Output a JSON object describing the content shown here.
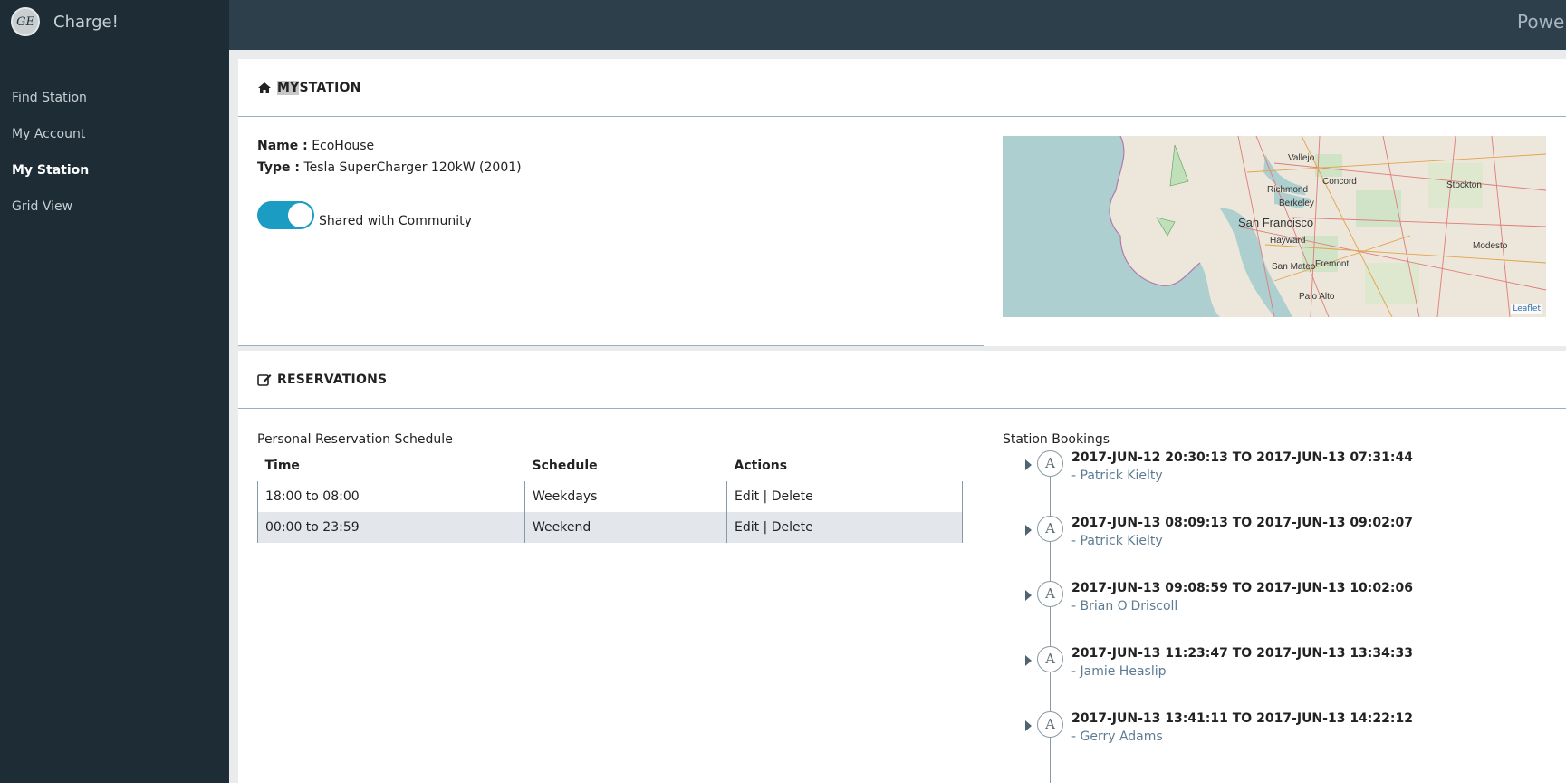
{
  "app": {
    "name": "Charge!",
    "logo_text": "GE",
    "topbar_title": "Powe"
  },
  "nav": {
    "items": [
      {
        "label": "Find Station"
      },
      {
        "label": "My Account"
      },
      {
        "label": "My Station",
        "active": true
      },
      {
        "label": "Grid View"
      }
    ]
  },
  "station": {
    "header_prefix": "MY",
    "header_rest": " STATION",
    "name_label": "Name :",
    "name_value": "EcoHouse",
    "type_label": "Type :",
    "type_value": "Tesla SuperCharger 120kW (2001)",
    "shared_label": "Shared with Community",
    "shared_on": true,
    "map": {
      "attribution": "Leaflet",
      "cities": [
        "Vallejo",
        "Concord",
        "Stockton",
        "Richmond",
        "Berkeley",
        "San Francisco",
        "Hayward",
        "Modesto",
        "San Mateo",
        "Fremont",
        "Palo Alto"
      ]
    }
  },
  "reservations": {
    "header": "RESERVATIONS",
    "personal_title": "Personal Reservation Schedule",
    "columns": [
      "Time",
      "Schedule",
      "Actions"
    ],
    "rows": [
      {
        "time": "18:00 to 08:00",
        "schedule": "Weekdays",
        "actions": "Edit | Delete"
      },
      {
        "time": "00:00 to 23:59",
        "schedule": "Weekend",
        "actions": "Edit | Delete"
      }
    ],
    "bookings_title": "Station Bookings",
    "bookings": [
      {
        "avatar": "A",
        "time": "2017-JUN-12 20:30:13 TO 2017-JUN-13 07:31:44",
        "user": "- Patrick Kielty"
      },
      {
        "avatar": "A",
        "time": "2017-JUN-13 08:09:13 TO 2017-JUN-13 09:02:07",
        "user": "- Patrick Kielty"
      },
      {
        "avatar": "A",
        "time": "2017-JUN-13 09:08:59 TO 2017-JUN-13 10:02:06",
        "user": "- Brian O'Driscoll"
      },
      {
        "avatar": "A",
        "time": "2017-JUN-13 11:23:47 TO 2017-JUN-13 13:34:33",
        "user": "- Jamie Heaslip"
      },
      {
        "avatar": "A",
        "time": "2017-JUN-13 13:41:11 TO 2017-JUN-13 14:22:12",
        "user": "- Gerry Adams"
      }
    ]
  },
  "colors": {
    "sidebar_bg": "#1d2c35",
    "topbar_bg": "#2c3f4b",
    "toggle_on": "#1a9cc3",
    "booking_user": "#5d7c93"
  }
}
